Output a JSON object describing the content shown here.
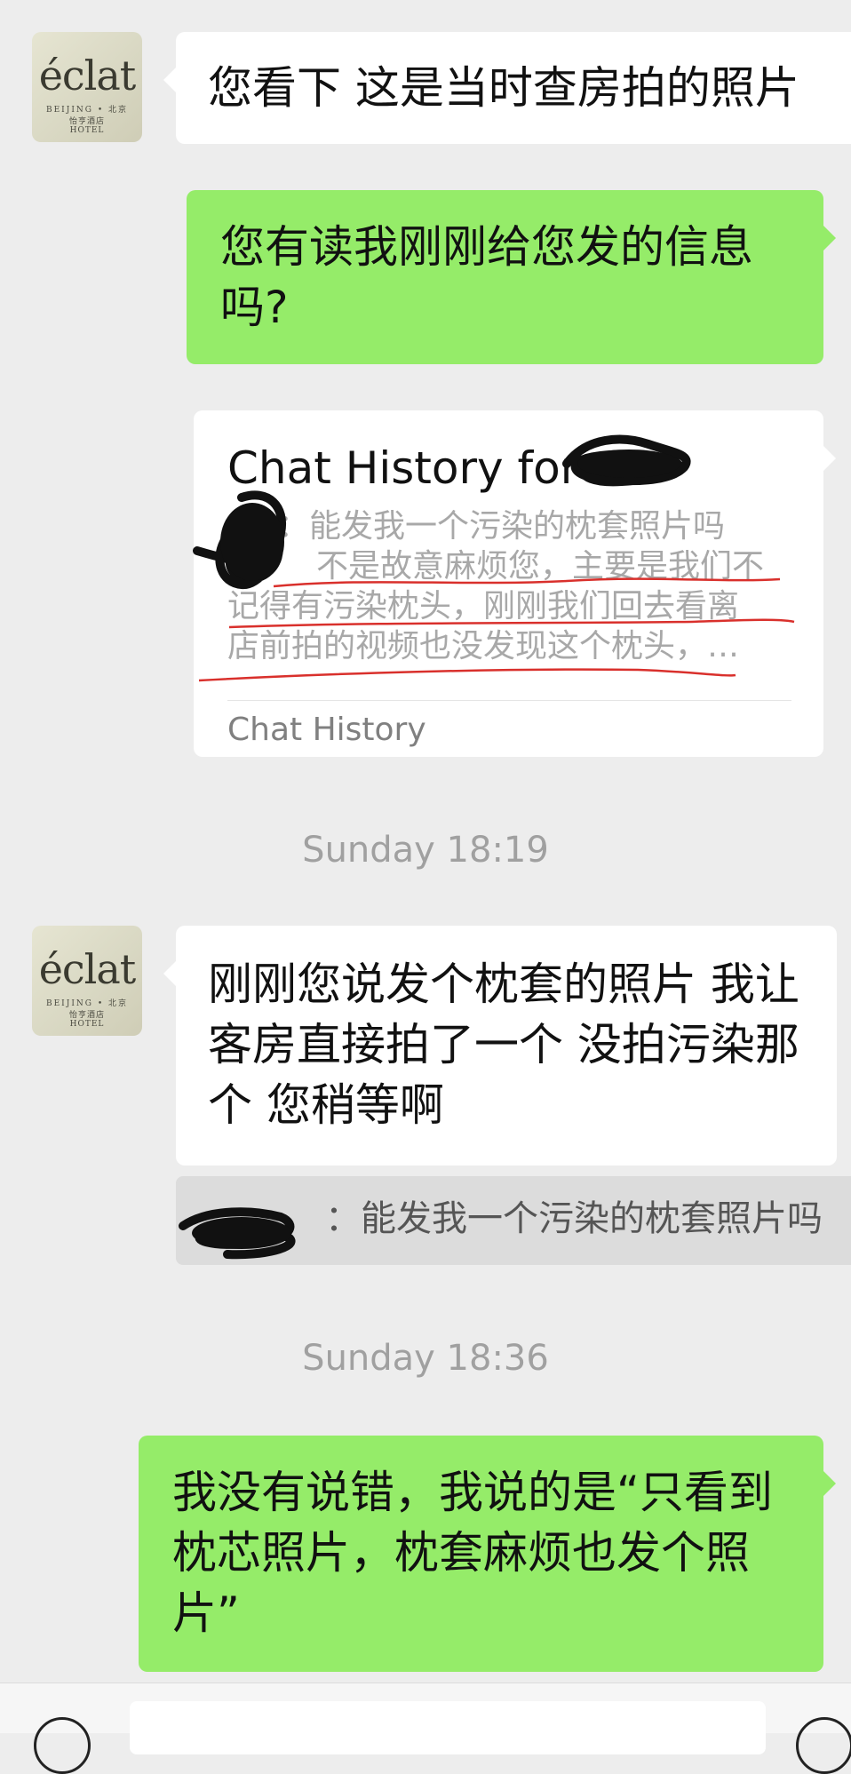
{
  "messages": [
    {
      "sender": "hotel",
      "text": "您看下 这是当时查房拍的照片"
    },
    {
      "sender": "me",
      "text": "您有读我刚刚给您发的信息吗?"
    },
    {
      "sender": "me",
      "text": "我没有说错，我说的是“只看到枕芯照片，枕套麻烦也发个照片”"
    },
    {
      "sender": "hotel",
      "text": "刚刚您说发个枕套的照片  我让客房直接拍了一个  没拍污染那个  您稍等啊"
    }
  ],
  "avatar": {
    "logo": "éclat",
    "line1": "BEIJING • 北京",
    "line2": "怡亨酒店",
    "line3": "HOTEL"
  },
  "chat_history_card": {
    "title": "Chat History for",
    "preview_line1": "：能发我一个污染的枕套照片吗",
    "preview_line2": "不是故意麻烦您，主要是我们不",
    "preview_line3": "记得有污染枕头，刚刚我们回去看离",
    "preview_line4": "店前拍的视频也没发现这个枕头，…",
    "footer": "Chat History"
  },
  "timestamps": {
    "first": "Sunday 18:19",
    "second": "Sunday 18:36"
  },
  "quote": {
    "text": "：能发我一个污染的枕套照片吗"
  },
  "colors": {
    "background": "#ededed",
    "bubble_green": "#95ec69",
    "bubble_white": "#ffffff",
    "timestamp_gray": "#a0a0a0"
  }
}
